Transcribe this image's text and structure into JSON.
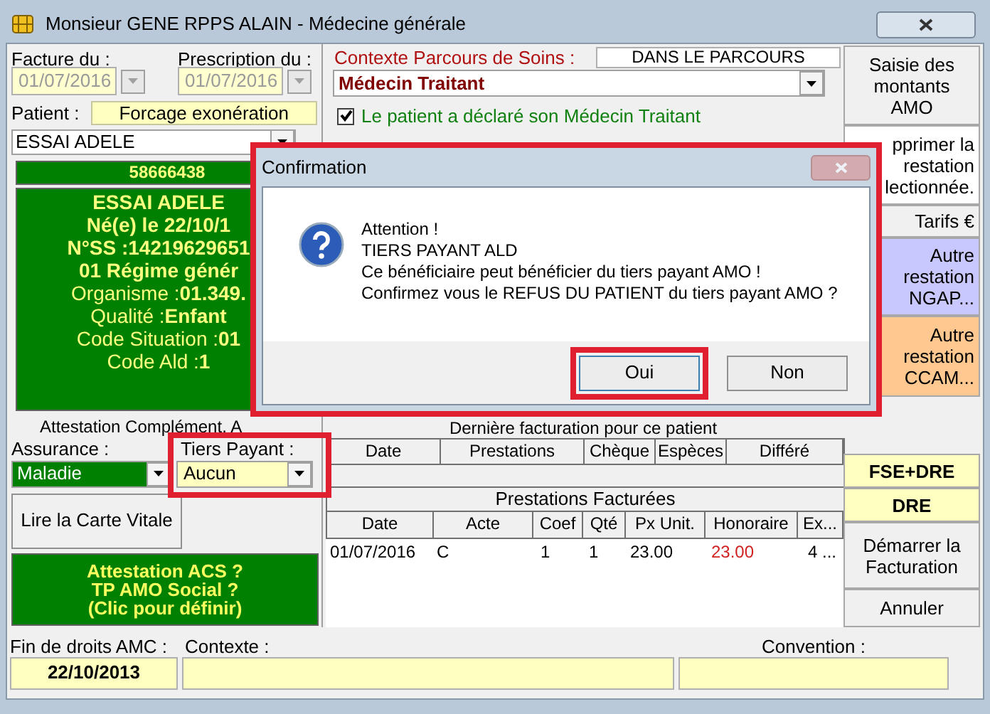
{
  "window": {
    "title": "Monsieur GENE RPPS ALAIN - Médecine générale"
  },
  "invoice_date": {
    "label": "Facture du :",
    "value": "01/07/2016",
    "disabled": true
  },
  "prescription_date": {
    "label": "Prescription du :",
    "value": "01/07/2016",
    "disabled": true
  },
  "patient": {
    "label": "Patient :",
    "value": "ESSAI ADELE"
  },
  "exemption_button": "Forcage exonération",
  "patient_card": {
    "number": "58666438",
    "lines": [
      {
        "text": "ESSAI ADELE",
        "kind": "bold"
      },
      {
        "text": "Né(e) le 22/10/1",
        "kind": "bold"
      },
      {
        "text": "N°SS :14219629651",
        "kind": "bold"
      },
      {
        "text": "01 Régime génér",
        "kind": "bold"
      },
      {
        "text": "Organisme :**01.349.**",
        "kind": "mixed"
      },
      {
        "text": "Qualité :**Enfant**",
        "kind": "mixed"
      },
      {
        "text": "Code Situation :**01**",
        "kind": "mixed"
      },
      {
        "text": "Code Ald :**1**",
        "kind": "mixed"
      }
    ]
  },
  "attestation_label": "Attestation Complément. A",
  "insurance": {
    "label": "Assurance :",
    "value": "Maladie"
  },
  "tiers_payant": {
    "label": "Tiers Payant :",
    "value": "Aucun",
    "highlighted": true
  },
  "read_card_button": "Lire la Carte Vitale",
  "acs_panel": [
    "Attestation ACS ?",
    "TP AMO Social ?",
    "(Clic pour définir)"
  ],
  "care_pathway": {
    "label": "Contexte Parcours de Soins  :",
    "status": "DANS LE PARCOURS",
    "value": "Médecin Traitant",
    "declared": {
      "label": "Le patient a déclaré son Médecin Traitant",
      "checked": true
    }
  },
  "last_billing": {
    "title": "Dernière facturation pour ce patient",
    "columns": [
      "Date",
      "Prestations",
      "Chèque",
      "Espèces",
      "Différé"
    ]
  },
  "billed": {
    "title": "Prestations Facturées",
    "columns": [
      {
        "label": "Date",
        "emphasis": false
      },
      {
        "label": "Acte",
        "emphasis": false
      },
      {
        "label": "Coef",
        "emphasis": false
      },
      {
        "label": "Qté",
        "emphasis": false
      },
      {
        "label": "Px Unit.",
        "emphasis": false
      },
      {
        "label": "Honoraire",
        "emphasis": true
      },
      {
        "label": "Ex...",
        "emphasis": false
      }
    ],
    "rows": [
      {
        "cells": [
          "01/07/2016",
          "C",
          "1",
          "1",
          "23.00",
          "23.00",
          "4 ..."
        ]
      }
    ]
  },
  "side_buttons": [
    {
      "lines": [
        "Saisie des",
        "montants",
        "AMO"
      ],
      "color": "#f0f0f0",
      "kind": "plain"
    },
    {
      "lines": [
        "pprimer la",
        "restation",
        "lectionnée."
      ],
      "color": "#ffffff",
      "kind": "partial"
    },
    {
      "lines": [
        "Tarifs €"
      ],
      "color": "#f0f0f0",
      "kind": "partial"
    },
    {
      "lines": [
        "Autre",
        "restation",
        "NGAP..."
      ],
      "color": "#c8c8ff",
      "kind": "partial"
    },
    {
      "lines": [
        "Autre",
        "restation",
        "CCAM..."
      ],
      "color": "#ffc890",
      "kind": "partial"
    }
  ],
  "billing_buttons": [
    {
      "lines": [
        "FSE+DRE"
      ],
      "color": "#ffffc0",
      "kind": "bold"
    },
    {
      "lines": [
        "DRE"
      ],
      "color": "#ffffc0",
      "kind": "bold"
    },
    {
      "lines": [
        "Démarrer la",
        "Facturation"
      ],
      "color": "#f0f0f0",
      "kind": "plain"
    },
    {
      "lines": [
        "Annuler"
      ],
      "color": "#f0f0f0",
      "kind": "plain"
    }
  ],
  "rights_end": {
    "label": "Fin de droits AMC :",
    "value": "22/10/2013"
  },
  "context": {
    "label": "Contexte :"
  },
  "convention": {
    "label": "Convention :"
  },
  "dialog": {
    "title": "Confirmation",
    "highlighted": true,
    "lines": [
      "Attention !",
      "TIERS PAYANT ALD",
      "Ce bénéficiaire peut bénéficier du tiers payant AMO !",
      "Confirmez vous le REFUS DU PATIENT du tiers payant AMO ?"
    ],
    "buttons": [
      {
        "label": "Oui",
        "highlighted": true
      },
      {
        "label": "Non",
        "highlighted": false
      }
    ]
  }
}
